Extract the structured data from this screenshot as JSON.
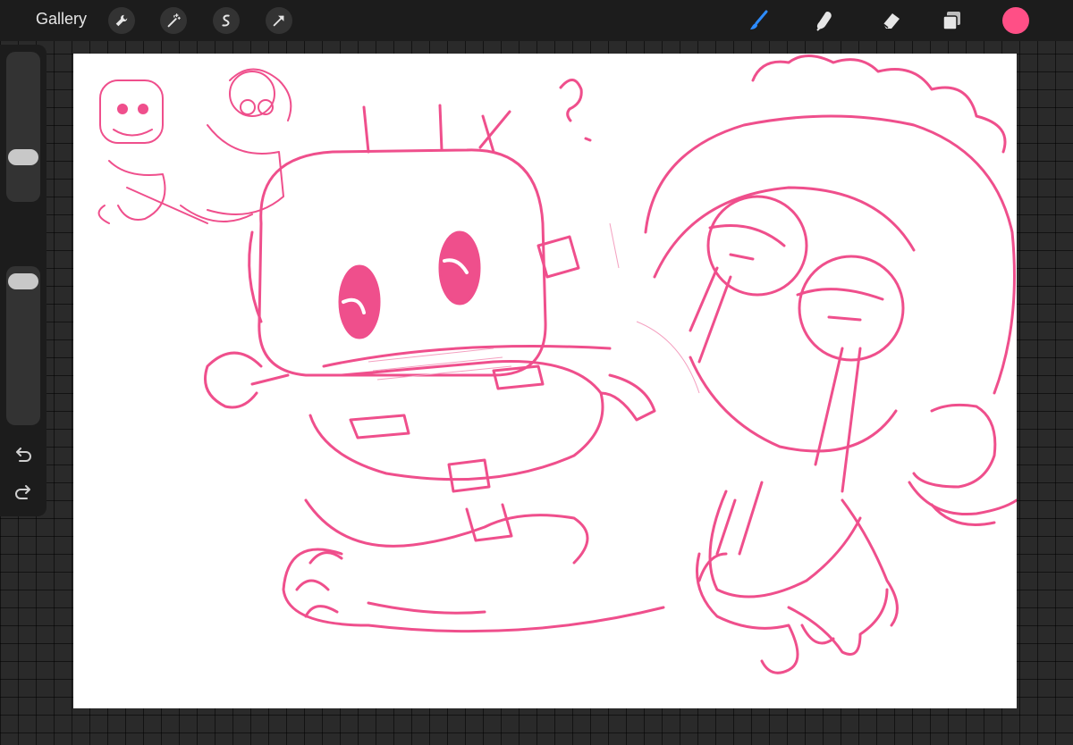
{
  "app": {
    "gallery_label": "Gallery"
  },
  "toolbar_left": [
    "wrench-icon",
    "magic-wand-icon",
    "selection-icon",
    "transform-arrow-icon"
  ],
  "toolbar_right": [
    "brush-icon",
    "smudge-icon",
    "eraser-icon",
    "layers-icon"
  ],
  "colors": {
    "accent_brush": "#2d8cff",
    "current_color": "#ff4f86",
    "sketch_stroke": "#ef4f8c"
  },
  "sidebar": {
    "brush_size_level": 0.75,
    "brush_opacity_level": 0.0,
    "controls": [
      "undo-icon",
      "redo-icon"
    ]
  }
}
